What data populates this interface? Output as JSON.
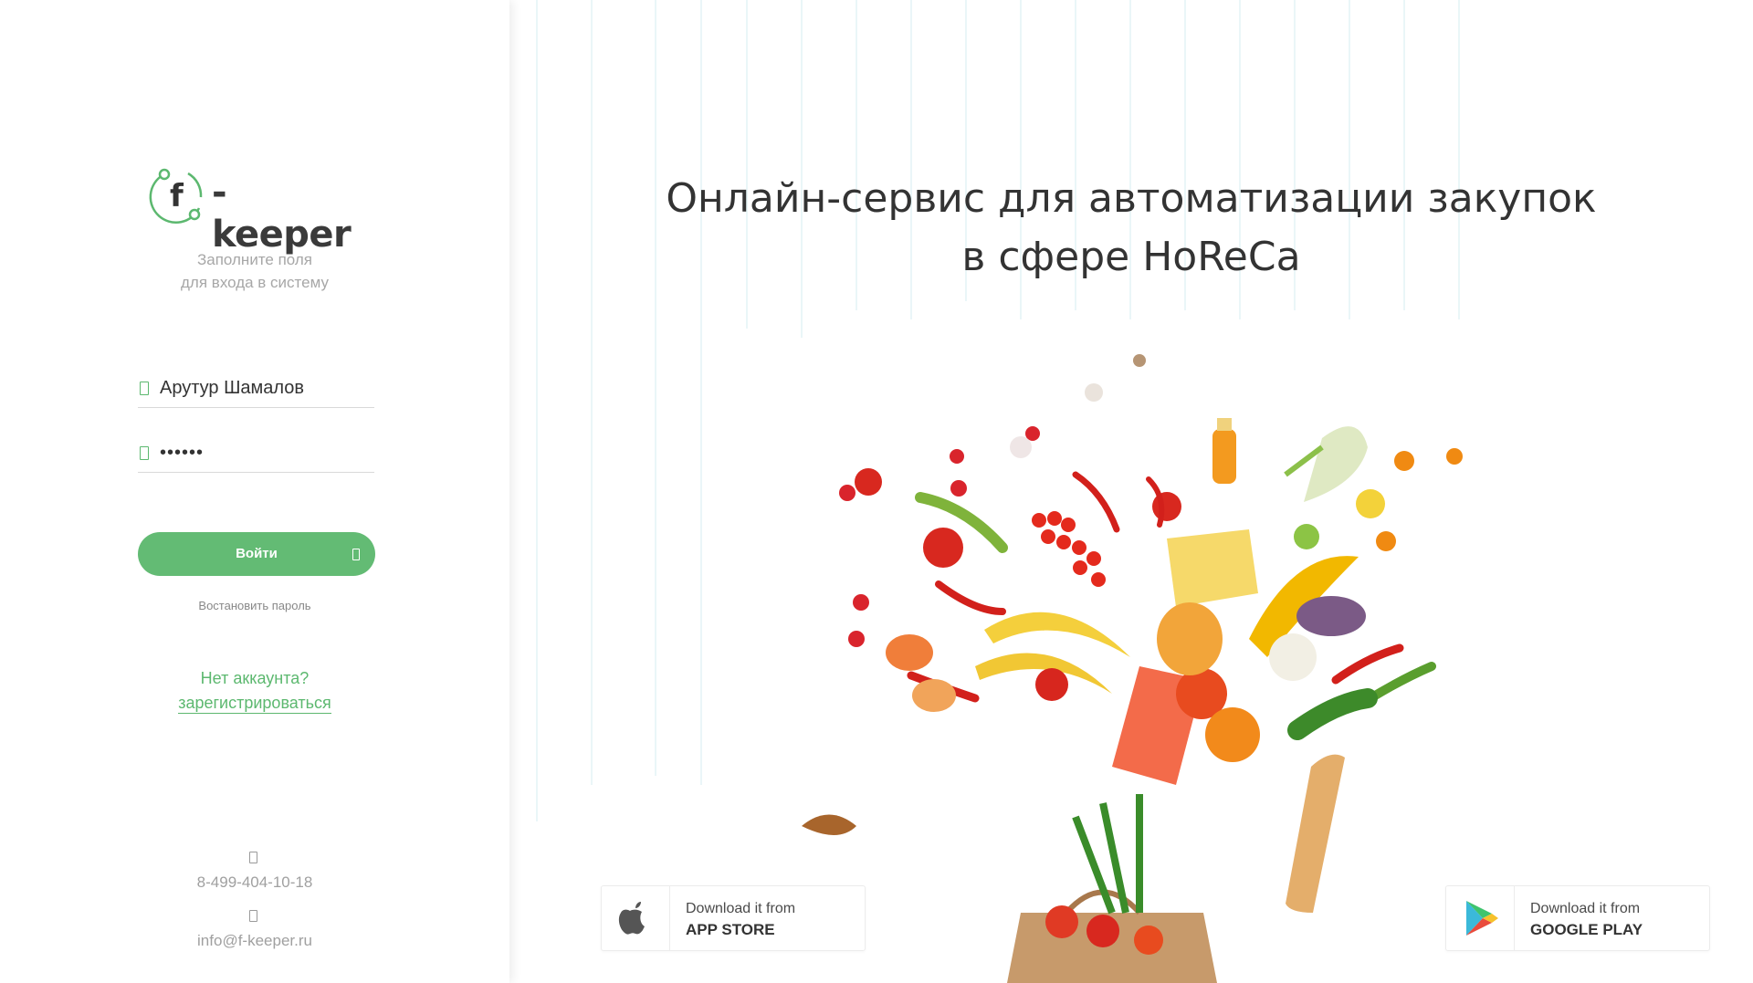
{
  "login": {
    "logo_text": "-keeper",
    "logo_letter": "f",
    "subtitle_line1": "Заполните поля",
    "subtitle_line2": "для входа в систему",
    "username_value": "Арутур Шамалов",
    "password_value": "••••••",
    "login_button": "Войти",
    "restore_password": "Востановить пароль",
    "no_account": "Нет аккаунта?",
    "register": "зарегистрироваться",
    "phone": "8-499-404-10-18",
    "email": "info@f-keeper.ru"
  },
  "hero": {
    "title_line1": "Онлайн-сервис для автоматизации закупок",
    "title_line2": "в сфере HoReCa"
  },
  "stores": {
    "appstore_small": "Download it from",
    "appstore_big": "APP STORE",
    "googleplay_small": "Download it from",
    "googleplay_big": "GOOGLE PLAY"
  },
  "colors": {
    "accent": "#63bb74",
    "text_dark": "#333333",
    "text_muted": "#a7a7a7"
  },
  "icons": {
    "user": "user-icon",
    "lock": "lock-icon",
    "login_arrow": "sign-in-icon",
    "phone": "phone-icon",
    "mail": "mail-icon",
    "apple": "apple-icon",
    "google_play": "google-play-icon"
  }
}
